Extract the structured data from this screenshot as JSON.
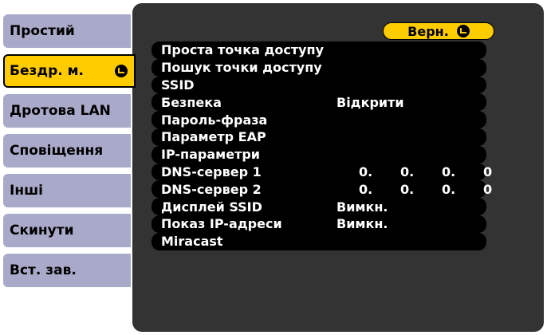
{
  "sidebar": {
    "tabs": [
      {
        "label": "Простий"
      },
      {
        "label": "Бездр. м.",
        "active": true
      },
      {
        "label": "Дротова LAN"
      },
      {
        "label": "Сповіщення"
      },
      {
        "label": "Інші"
      },
      {
        "label": "Скинути"
      },
      {
        "label": "Вст. зав."
      }
    ]
  },
  "panel": {
    "back_label": "Верн.",
    "rows": [
      {
        "label": "Проста точка доступу"
      },
      {
        "label": "Пошук точки доступу"
      },
      {
        "label": "SSID"
      },
      {
        "label": "Безпека",
        "value": "Відкрити"
      },
      {
        "label": "Пароль-фраза"
      },
      {
        "label": "Параметр EAP"
      },
      {
        "label": "IP-параметри"
      },
      {
        "label": "DNS-сервер 1",
        "ip": [
          "0.",
          "0.",
          "0.",
          "0"
        ]
      },
      {
        "label": "DNS-сервер 2",
        "ip": [
          "0.",
          "0.",
          "0.",
          "0"
        ]
      },
      {
        "label": "Дисплей SSID",
        "value": "Вимкн."
      },
      {
        "label": "Показ IP-адреси",
        "value": "Вимкн."
      },
      {
        "label": "Miracast"
      }
    ]
  },
  "colors": {
    "accent": "#ffcc00",
    "tab": "#a9a9c9",
    "panel": "#333333"
  },
  "icons": {
    "enter": "enter-icon"
  }
}
